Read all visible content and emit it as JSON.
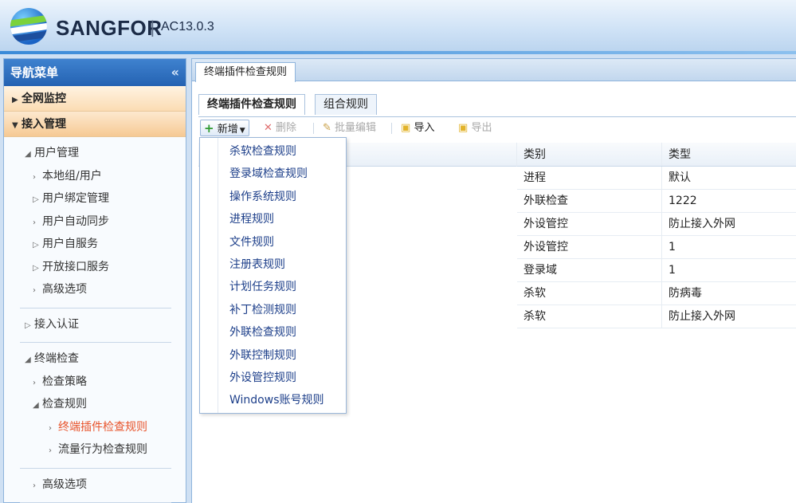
{
  "header": {
    "brand": "SANGFOR",
    "separator": "|",
    "version": "AC13.0.3"
  },
  "sidebar": {
    "title": "导航菜单",
    "collapse_glyph": "«",
    "sections": [
      {
        "label": "全网监控",
        "expanded": false
      },
      {
        "label": "接入管理",
        "expanded": true
      }
    ],
    "tree": {
      "user_mgmt": "用户管理",
      "local_group": "本地组/用户",
      "user_binding": "用户绑定管理",
      "user_sync": "用户自动同步",
      "user_self_service": "用户自服务",
      "open_api": "开放接口服务",
      "advanced_1": "高级选项",
      "access_auth": "接入认证",
      "terminal_check": "终端检查",
      "check_policy": "检查策略",
      "check_rules": "检查规则",
      "plugin_rules": "终端插件检查规则",
      "traffic_rules": "流量行为检查规则",
      "advanced_2": "高级选项"
    }
  },
  "content": {
    "main_tab": "终端插件检查规则",
    "subtabs": [
      "终端插件检查规则",
      "组合规则"
    ],
    "toolbar": {
      "new": "新增",
      "delete": "删除",
      "batch_edit": "批量编辑",
      "import": "导入",
      "export": "导出"
    },
    "table": {
      "columns": [
        "类别",
        "类型"
      ],
      "rows": [
        [
          "进程",
          "默认"
        ],
        [
          "外联检查",
          "1222"
        ],
        [
          "外设管控",
          "防止接入外网"
        ],
        [
          "外设管控",
          "1"
        ],
        [
          "登录域",
          "1"
        ],
        [
          "杀软",
          "防病毒"
        ],
        [
          "杀软",
          "防止接入外网"
        ]
      ]
    },
    "dropdown_items": [
      "杀软检查规则",
      "登录域检查规则",
      "操作系统规则",
      "进程规则",
      "文件规则",
      "注册表规则",
      "计划任务规则",
      "补丁检测规则",
      "外联检查规则",
      "外联控制规则",
      "外设管控规则",
      "Windows账号规则"
    ]
  },
  "colors": {
    "accent": "#2462b2",
    "active_item": "#e8542c",
    "menu_text": "#1d3f8a"
  }
}
